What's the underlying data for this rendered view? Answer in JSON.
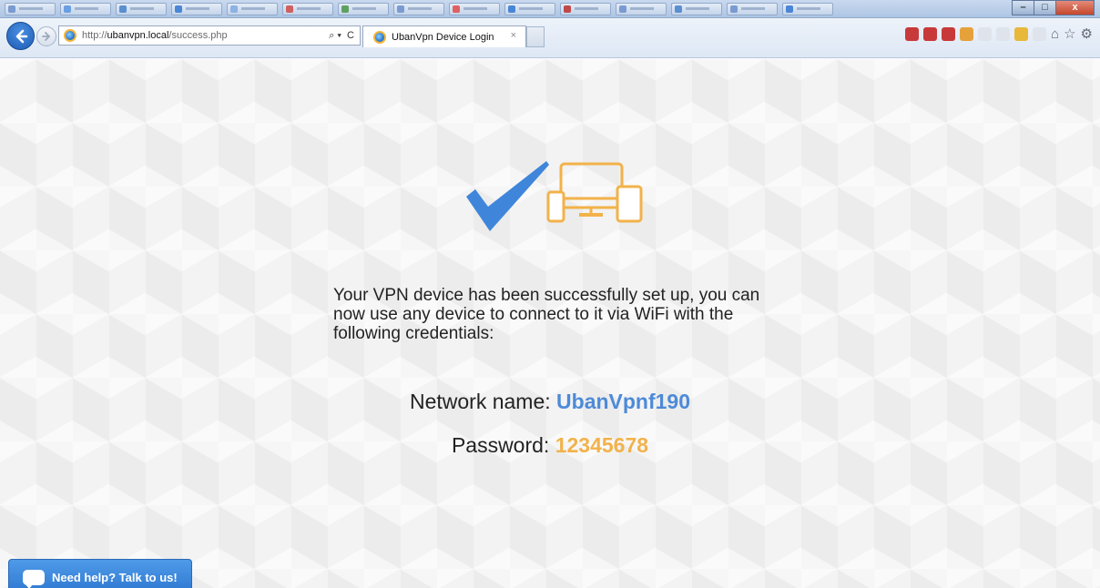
{
  "browser": {
    "address_prefix": "http://",
    "address_host": "ubanvpn.local",
    "address_path": "/success.php",
    "search_glyph": "⌕ ▾",
    "refresh_glyph": "C",
    "tab_title": "UbanVpn Device Login",
    "tab_close": "×",
    "window_minimize": "–",
    "window_maximize": "□",
    "window_close": "x",
    "home_glyph": "⌂",
    "favorites_glyph": "☆",
    "tools_glyph": "⚙"
  },
  "strip_tab_colors": [
    "#7a9bd1",
    "#6aa0e0",
    "#5a8fd0",
    "#4a86d6",
    "#8db2e3",
    "#d06060",
    "#5fa05f",
    "#7a9bd1",
    "#e06060",
    "#4a86d6",
    "#c04848",
    "#7a9bd1",
    "#5a8fd0",
    "#7a9bd1",
    "#4a86d6"
  ],
  "toolbar_icon_colors": [
    "#c83a3a",
    "#c83a3a",
    "#c83a3a",
    "#e5a23b",
    "#dfe4ec",
    "#dfe4ec",
    "#e8b83a",
    "#dfe4ec"
  ],
  "colors": {
    "check_blue": "#3f86db",
    "device_orange": "#f2b24a",
    "network_name": "#4d8ad8",
    "password": "#f2b24a",
    "help_button": "#3a86dd"
  },
  "content": {
    "message": "Your VPN device has been successfully set up, you can now use any device to connect to it via WiFi with the following credentials:",
    "network_label": "Network name: ",
    "network_value": "UbanVpnf190",
    "password_label": "Password: ",
    "password_value": "12345678"
  },
  "help": {
    "label": "Need help? Talk to us!"
  }
}
